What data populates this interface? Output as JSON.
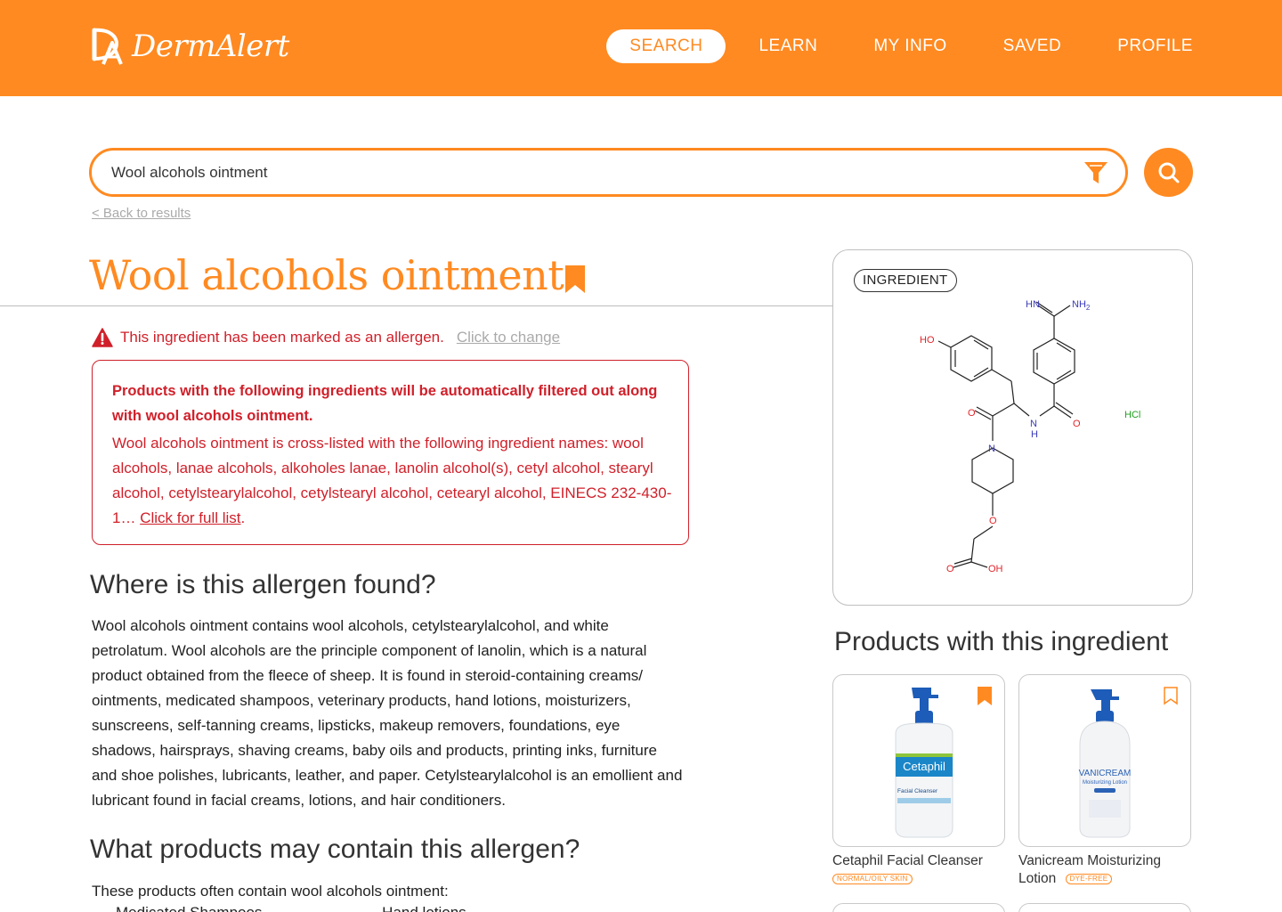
{
  "header": {
    "brand": "DermAlert",
    "nav": [
      {
        "label": "SEARCH",
        "active": true
      },
      {
        "label": "LEARN",
        "active": false
      },
      {
        "label": "MY INFO",
        "active": false
      },
      {
        "label": "SAVED",
        "active": false
      },
      {
        "label": "PROFILE",
        "active": false
      }
    ]
  },
  "search": {
    "value": "Wool alcohols ointment",
    "back_link": "< Back to results"
  },
  "ingredient": {
    "title": "Wool alcohols ointment",
    "saved": true,
    "allergen_notice": "This ingredient has been marked as an allergen.",
    "change_link": "Click to change",
    "filter_warning": "Products with the following ingredients will be automatically filtered out along with wool alcohols ointment.",
    "cross_listed": "Wool alcohols ointment is cross-listed with the following ingredient names: wool alcohols, lanae alcohols, alkoholes lanae, lanolin alcohol(s), cetyl alcohol, stearyl alcohol, cetylstearylalcohol, cetylstearyl alcohol, cetearyl alcohol, EINECS 232-430-1… ",
    "full_list_link": "Click for full list",
    "full_list_suffix": "."
  },
  "sections": {
    "where_title": "Where is this allergen found?",
    "where_body": "Wool alcohols ointment contains wool alcohols, cetylstearylalcohol, and white petrolatum. Wool alcohols are the principle component of lanolin, which is a natural product obtained from the fleece of sheep. It is found in steroid-containing creams/ ointments, medicated shampoos, veterinary products, hand lotions, moisturizers, sunscreens, self-tanning creams, lipsticks, makeup removers, foundations, eye shadows, hairsprays, shaving creams, baby oils and products, printing inks, furniture and shoe polishes, lubricants, leather, and paper. Cetylstearylalcohol is an emollient and lubricant found in facial creams, lotions, and hair conditioners.",
    "products_title": "What products may contain this allergen?",
    "products_intro": "These products often contain wool alcohols ointment:",
    "products_list": [
      "Medicated Shampoos",
      "Hand lotions"
    ]
  },
  "structure_card": {
    "badge": "INGREDIENT",
    "atoms": {
      "ho": "HO",
      "hn": "HN",
      "nh2": "NH",
      "nh2_sub": "2",
      "o_left": "O",
      "n_amide": "N",
      "h_amide": "H",
      "o_right": "O",
      "n_ring": "N",
      "o_ether": "O",
      "o_acid": "O",
      "oh_acid": "OH",
      "hcl": "HCl"
    },
    "colors": {
      "oxygen": "#e0252a",
      "nitrogen": "#3a3ab8",
      "chlorine": "#1fa01f",
      "bond": "#222222"
    }
  },
  "products": {
    "title": "Products with this ingredient",
    "items": [
      {
        "name": "Cetaphil Facial Cleanser",
        "tag": "NORMAL/OILY SKIN",
        "saved": true,
        "bottle_text": "Cetaphil",
        "bottle_sub": "Facial Cleanser"
      },
      {
        "name": "Vanicream Moisturizing Lotion",
        "tag": "DYE-FREE",
        "saved": false,
        "bottle_text": "VANICREAM",
        "bottle_sub": "Moisturizing Lotion"
      }
    ]
  },
  "theme": {
    "accent": "#ff8a21",
    "alert": "#d0202a"
  }
}
